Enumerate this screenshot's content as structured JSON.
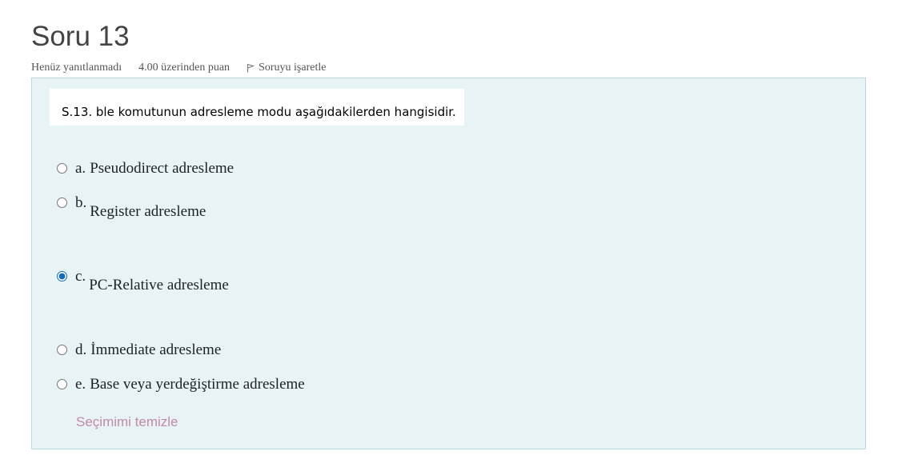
{
  "question": {
    "title": "Soru 13",
    "status": "Henüz yanıtlanmadı",
    "points": "4.00 üzerinden puan",
    "flag_label": "Soruyu işaretle",
    "text": "S.13. ble komutunun adresleme modu aşağıdakilerden hangisidir."
  },
  "options": [
    {
      "letter": "a.",
      "text": "Pseudodirect adresleme",
      "checked": false
    },
    {
      "letter": "b.",
      "text": "Register adresleme",
      "checked": false
    },
    {
      "letter": "c.",
      "text": "PC-Relative adresleme",
      "checked": true
    },
    {
      "letter": "d.",
      "text": "İmmediate adresleme",
      "checked": false
    },
    {
      "letter": "e.",
      "text": "Base veya yerdeğiştirme adresleme",
      "checked": false
    }
  ],
  "clear_label": "Seçimimi temizle",
  "colors": {
    "panel_bg": "#e7f3f5",
    "panel_border": "#b8dce2",
    "link": "#c58aa8",
    "radio_accent": "#0f6cbf"
  }
}
